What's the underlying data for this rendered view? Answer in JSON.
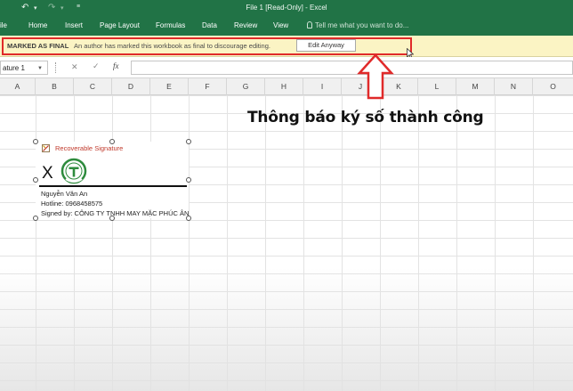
{
  "titlebar": {
    "title": "File 1  [Read-Only] - Excel"
  },
  "tabs": [
    {
      "label": "ile"
    },
    {
      "label": "Home"
    },
    {
      "label": "Insert"
    },
    {
      "label": "Page Layout"
    },
    {
      "label": "Formulas"
    },
    {
      "label": "Data"
    },
    {
      "label": "Review"
    },
    {
      "label": "View"
    }
  ],
  "tellme": "Tell me what you want to do...",
  "message_bar": {
    "label": "MARKED AS FINAL",
    "text": "An author has marked this workbook as final to discourage editing.",
    "button": "Edit Anyway"
  },
  "formula_bar": {
    "name_box": "ature 1",
    "fx": "fx",
    "value": ""
  },
  "columns": [
    "A",
    "B",
    "C",
    "D",
    "E",
    "F",
    "G",
    "H",
    "I",
    "J",
    "K",
    "L",
    "M",
    "N",
    "O"
  ],
  "annotation": {
    "note": "Thông báo ký số thành công"
  },
  "signature": {
    "header": "Recoverable Signature",
    "x_mark": "X",
    "name": "Nguyễn Văn An",
    "phone": "Hotline: 0968458575",
    "signed_by": "Signed by: CÔNG TY TNHH MAY MẶC PHÚC ÂN"
  },
  "colors": {
    "ribbon": "#217346",
    "message_bar": "#fbf4c4",
    "highlight": "#e02a2a",
    "logo": "#2e8b3d"
  }
}
